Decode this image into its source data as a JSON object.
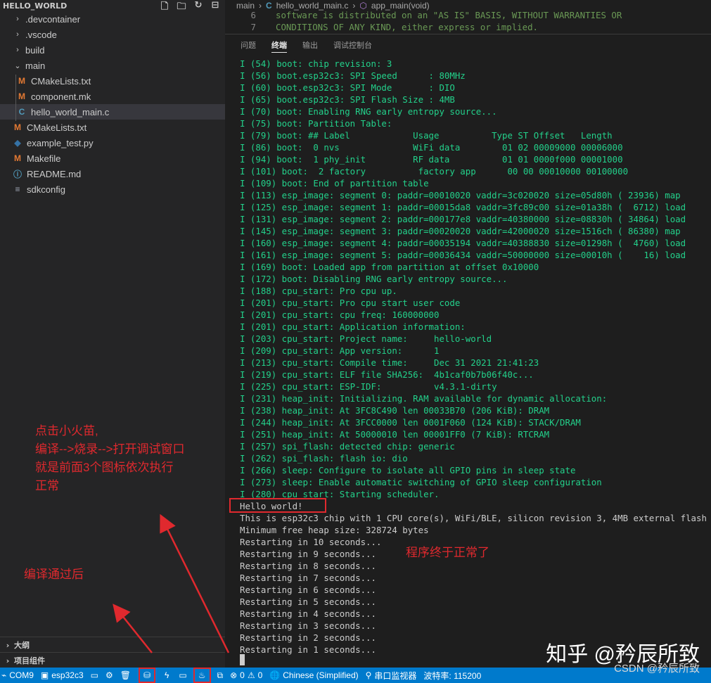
{
  "explorer": {
    "title": "HELLO_WORLD",
    "items": [
      {
        "label": ".devcontainer",
        "kind": "folder",
        "state": "collapsed",
        "depth": 1
      },
      {
        "label": ".vscode",
        "kind": "folder",
        "state": "collapsed",
        "depth": 1
      },
      {
        "label": "build",
        "kind": "folder",
        "state": "collapsed",
        "depth": 1
      },
      {
        "label": "main",
        "kind": "folder",
        "state": "expanded",
        "depth": 1
      },
      {
        "label": "CMakeLists.txt",
        "kind": "cmake",
        "icon": "M",
        "depth": 2
      },
      {
        "label": "component.mk",
        "kind": "make",
        "icon": "M",
        "depth": 2
      },
      {
        "label": "hello_world_main.c",
        "kind": "c",
        "icon": "C",
        "depth": 2,
        "selected": true
      },
      {
        "label": "CMakeLists.txt",
        "kind": "cmake",
        "icon": "M",
        "depth": 1
      },
      {
        "label": "example_test.py",
        "kind": "python",
        "icon": "py",
        "depth": 1
      },
      {
        "label": "Makefile",
        "kind": "make",
        "icon": "M",
        "depth": 1
      },
      {
        "label": "README.md",
        "kind": "info",
        "icon": "i",
        "depth": 1
      },
      {
        "label": "sdkconfig",
        "kind": "config",
        "icon": "≡",
        "depth": 1
      }
    ],
    "outline_label": "大纲",
    "project_label": "项目组件"
  },
  "annotations": {
    "left_note_lines": [
      "点击小火苗,",
      "编译-->烧录-->打开调试窗口",
      "就是前面3个图标依次执行",
      "正常"
    ],
    "compile_note": "编译通过后",
    "success_note": "程序终于正常了"
  },
  "breadcrumb": {
    "folder": "main",
    "file": "hello_world_main.c",
    "symbol": "app_main(void)"
  },
  "code_lines": [
    {
      "num": "6",
      "text": "software is distributed on an \"AS IS\" BASIS, WITHOUT WARRANTIES OR"
    },
    {
      "num": "7",
      "text": "CONDITIONS OF ANY KIND, either express or implied."
    }
  ],
  "panel_tabs": [
    "问题",
    "终端",
    "输出",
    "调试控制台"
  ],
  "active_tab": "终端",
  "terminal_lines": [
    {
      "c": "g",
      "t": "I (54) boot: chip revision: 3"
    },
    {
      "c": "g",
      "t": "I (56) boot.esp32c3: SPI Speed      : 80MHz"
    },
    {
      "c": "g",
      "t": "I (60) boot.esp32c3: SPI Mode       : DIO"
    },
    {
      "c": "g",
      "t": "I (65) boot.esp32c3: SPI Flash Size : 4MB"
    },
    {
      "c": "g",
      "t": "I (70) boot: Enabling RNG early entropy source..."
    },
    {
      "c": "g",
      "t": "I (75) boot: Partition Table:"
    },
    {
      "c": "g",
      "t": "I (79) boot: ## Label            Usage          Type ST Offset   Length"
    },
    {
      "c": "g",
      "t": "I (86) boot:  0 nvs              WiFi data        01 02 00009000 00006000"
    },
    {
      "c": "g",
      "t": "I (94) boot:  1 phy_init         RF data          01 01 0000f000 00001000"
    },
    {
      "c": "g",
      "t": "I (101) boot:  2 factory          factory app      00 00 00010000 00100000"
    },
    {
      "c": "g",
      "t": "I (109) boot: End of partition table"
    },
    {
      "c": "g",
      "t": "I (113) esp_image: segment 0: paddr=00010020 vaddr=3c020020 size=05d80h ( 23936) map"
    },
    {
      "c": "g",
      "t": "I (125) esp_image: segment 1: paddr=00015da8 vaddr=3fc89c00 size=01a38h (  6712) load"
    },
    {
      "c": "g",
      "t": "I (131) esp_image: segment 2: paddr=000177e8 vaddr=40380000 size=08830h ( 34864) load"
    },
    {
      "c": "g",
      "t": "I (145) esp_image: segment 3: paddr=00020020 vaddr=42000020 size=1516ch ( 86380) map"
    },
    {
      "c": "g",
      "t": "I (160) esp_image: segment 4: paddr=00035194 vaddr=40388830 size=01298h (  4760) load"
    },
    {
      "c": "g",
      "t": "I (161) esp_image: segment 5: paddr=00036434 vaddr=50000000 size=00010h (    16) load"
    },
    {
      "c": "g",
      "t": "I (169) boot: Loaded app from partition at offset 0x10000"
    },
    {
      "c": "g",
      "t": "I (172) boot: Disabling RNG early entropy source..."
    },
    {
      "c": "g",
      "t": "I (188) cpu_start: Pro cpu up."
    },
    {
      "c": "g",
      "t": "I (201) cpu_start: Pro cpu start user code"
    },
    {
      "c": "g",
      "t": "I (201) cpu_start: cpu freq: 160000000"
    },
    {
      "c": "g",
      "t": "I (201) cpu_start: Application information:"
    },
    {
      "c": "g",
      "t": "I (203) cpu_start: Project name:     hello-world"
    },
    {
      "c": "g",
      "t": "I (209) cpu_start: App version:      1"
    },
    {
      "c": "g",
      "t": "I (213) cpu_start: Compile time:     Dec 31 2021 21:41:23"
    },
    {
      "c": "g",
      "t": "I (219) cpu_start: ELF file SHA256:  4b1caf0b7b06f40c..."
    },
    {
      "c": "g",
      "t": "I (225) cpu_start: ESP-IDF:          v4.3.1-dirty"
    },
    {
      "c": "g",
      "t": "I (231) heap_init: Initializing. RAM available for dynamic allocation:"
    },
    {
      "c": "g",
      "t": "I (238) heap_init: At 3FC8C490 len 00033B70 (206 KiB): DRAM"
    },
    {
      "c": "g",
      "t": "I (244) heap_init: At 3FCC0000 len 0001F060 (124 KiB): STACK/DRAM"
    },
    {
      "c": "g",
      "t": "I (251) heap_init: At 50000010 len 00001FF0 (7 KiB): RTCRAM"
    },
    {
      "c": "g",
      "t": "I (257) spi_flash: detected chip: generic"
    },
    {
      "c": "g",
      "t": "I (262) spi_flash: flash io: dio"
    },
    {
      "c": "g",
      "t": "I (266) sleep: Configure to isolate all GPIO pins in sleep state"
    },
    {
      "c": "g",
      "t": "I (273) sleep: Enable automatic switching of GPIO sleep configuration"
    },
    {
      "c": "g",
      "t": "I (280) cpu_start: Starting scheduler."
    },
    {
      "c": "w",
      "t": "Hello world!"
    },
    {
      "c": "w",
      "t": "This is esp32c3 chip with 1 CPU core(s), WiFi/BLE, silicon revision 3, 4MB external flash"
    },
    {
      "c": "w",
      "t": "Minimum free heap size: 328724 bytes"
    },
    {
      "c": "w",
      "t": "Restarting in 10 seconds..."
    },
    {
      "c": "w",
      "t": "Restarting in 9 seconds..."
    },
    {
      "c": "w",
      "t": "Restarting in 8 seconds..."
    },
    {
      "c": "w",
      "t": "Restarting in 7 seconds..."
    },
    {
      "c": "w",
      "t": "Restarting in 6 seconds..."
    },
    {
      "c": "w",
      "t": "Restarting in 5 seconds..."
    },
    {
      "c": "w",
      "t": "Restarting in 4 seconds..."
    },
    {
      "c": "w",
      "t": "Restarting in 3 seconds..."
    },
    {
      "c": "w",
      "t": "Restarting in 2 seconds..."
    },
    {
      "c": "w",
      "t": "Restarting in 1 seconds..."
    }
  ],
  "statusbar": {
    "port": "COM9",
    "target": "esp32c3",
    "problems_errors": "0",
    "problems_warnings": "0",
    "language": "Chinese (Simplified)",
    "serial_monitor": "串口监视器",
    "baud_rate": "波特率: 115200"
  },
  "watermark": {
    "main": "知乎 @矜辰所致",
    "sub": "CSDN @矜辰所致"
  },
  "colors": {
    "accent": "#007acc",
    "terminal_green": "#23d18b",
    "annotation_red": "#e0292e",
    "sidebar_bg": "#252526",
    "editor_bg": "#1e1e1e"
  }
}
